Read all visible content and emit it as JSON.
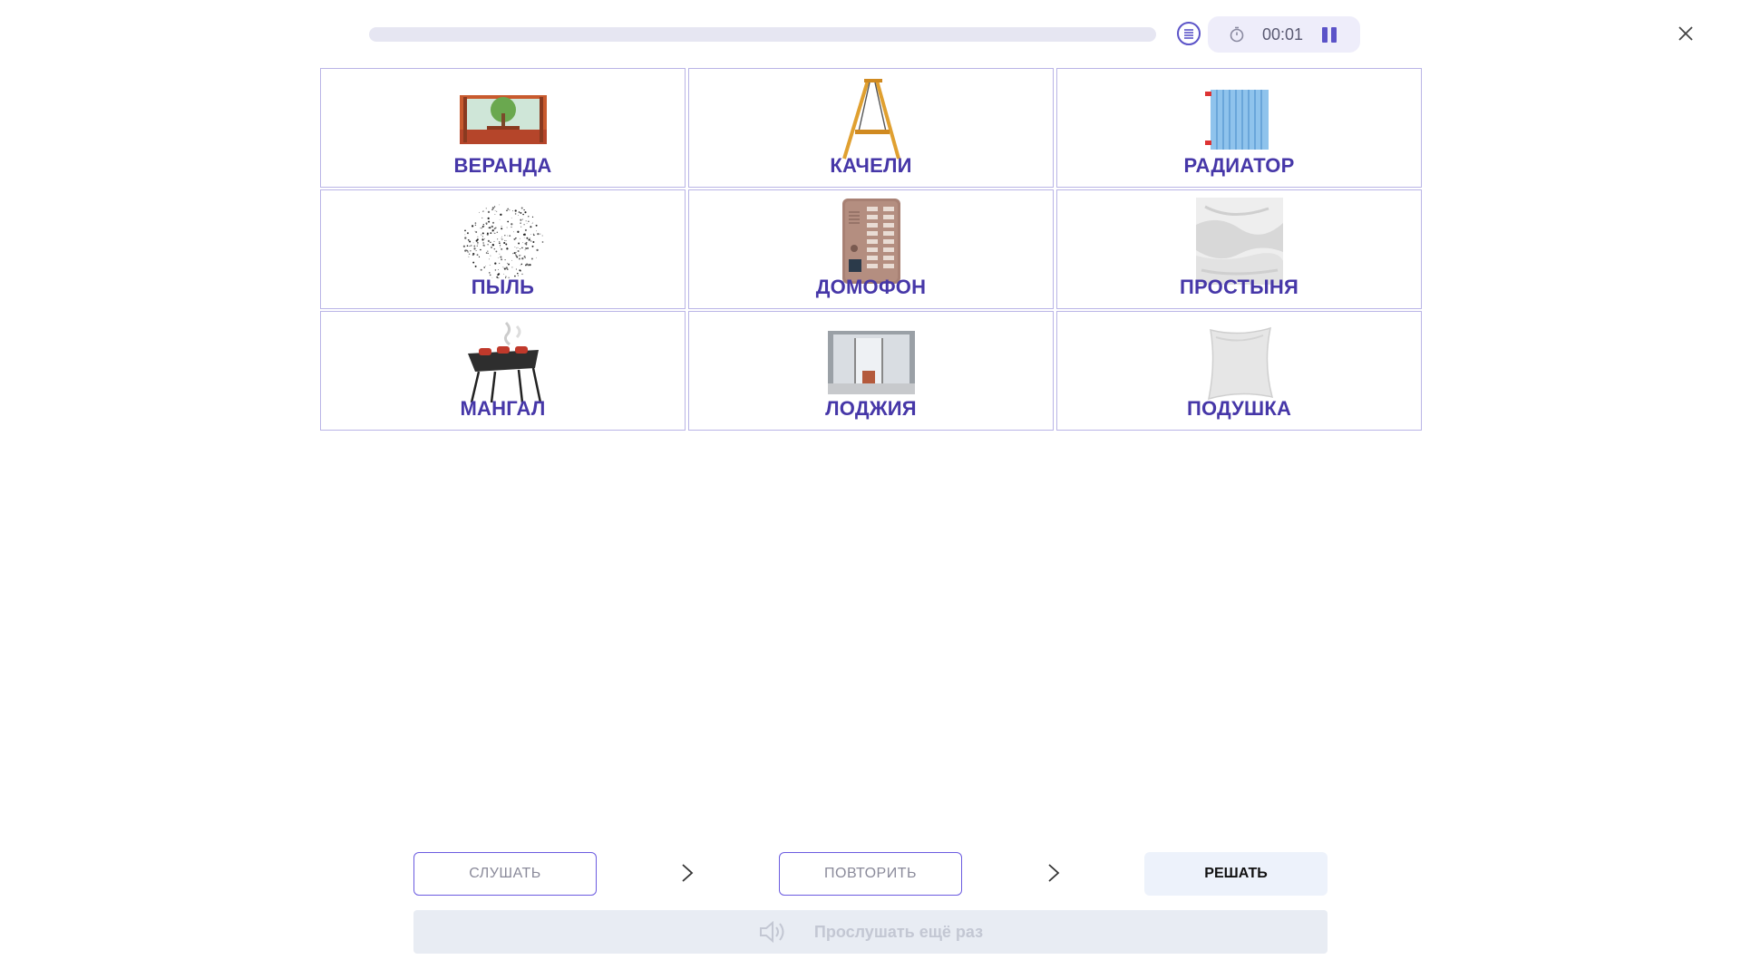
{
  "timer": {
    "time": "00:01"
  },
  "progress": {
    "value": 0
  },
  "cards": [
    {
      "label": "ВЕРАНДА",
      "icon": "veranda-image"
    },
    {
      "label": "КАЧЕЛИ",
      "icon": "swing-image"
    },
    {
      "label": "РАДИАТОР",
      "icon": "radiator-image"
    },
    {
      "label": "ПЫЛЬ",
      "icon": "dust-image"
    },
    {
      "label": "ДОМОФОН",
      "icon": "intercom-image"
    },
    {
      "label": "ПРОСТЫНЯ",
      "icon": "bedsheet-image"
    },
    {
      "label": "МАНГАЛ",
      "icon": "grill-image"
    },
    {
      "label": "ЛОДЖИЯ",
      "icon": "loggia-image"
    },
    {
      "label": "ПОДУШКА",
      "icon": "pillow-image"
    }
  ],
  "controls": {
    "listen": "СЛУШАТЬ",
    "repeat": "ПОВТОРИТЬ",
    "solve": "РЕШАТЬ",
    "replay": "Прослушать ещё раз"
  },
  "colors": {
    "accent": "#5b53c8",
    "label": "#4637a8",
    "card_border": "#b9b4e6"
  }
}
